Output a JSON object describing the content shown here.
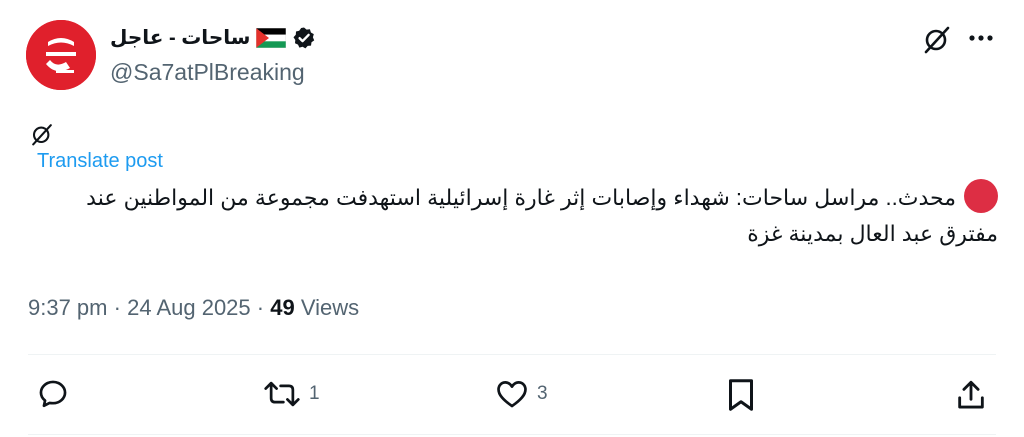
{
  "author": {
    "name": "ساحات - عاجل",
    "handle": "@Sa7atPlBreaking",
    "verified": true,
    "flag": "palestine-flag"
  },
  "translate_label": "Translate post",
  "post_text": "محدث.. مراسل ساحات: شهداء وإصابات إثر غارة إسرائيلية استهدفت مجموعة من المواطنين عند مفترق عبد العال بمدينة غزة",
  "meta": {
    "time": "9:37 pm",
    "separator": "·",
    "date": "24 Aug 2025",
    "views_count": "49",
    "views_label": "Views"
  },
  "actions": {
    "reply_count": "",
    "repost_count": "1",
    "like_count": "3"
  },
  "colors": {
    "accent": "#1d9bf0",
    "secondary_text": "#536471",
    "avatar_bg": "#e0202c",
    "dot": "#dd2e44"
  }
}
